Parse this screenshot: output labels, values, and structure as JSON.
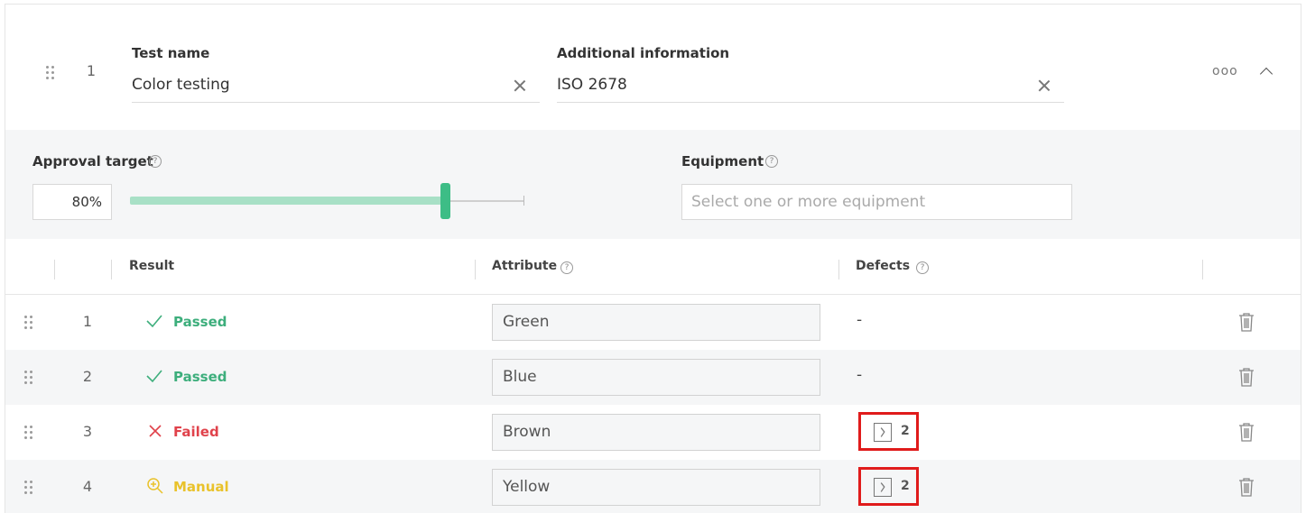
{
  "header": {
    "index": "1",
    "test_name_label": "Test name",
    "test_name_value": "Color testing",
    "additional_label": "Additional information",
    "additional_value": "ISO 2678",
    "more_icon": "ooo",
    "collapse_icon": "chevron-up-icon"
  },
  "settings": {
    "approval_label": "Approval target",
    "approval_value": "80%",
    "approval_level": 0.8,
    "equipment_label": "Equipment",
    "equipment_placeholder": "Select one or more equipment",
    "help_icon": "?"
  },
  "table": {
    "columns": [
      "Result",
      "Attribute",
      "Defects"
    ],
    "rows": [
      {
        "index": "1",
        "result": "Passed",
        "status": "passed",
        "attribute": "Green",
        "defects": "-"
      },
      {
        "index": "2",
        "result": "Passed",
        "status": "passed",
        "attribute": "Blue",
        "defects": "-"
      },
      {
        "index": "3",
        "result": "Failed",
        "status": "failed",
        "attribute": "Brown",
        "defects": "2"
      },
      {
        "index": "4",
        "result": "Manual",
        "status": "manual",
        "attribute": "Yellow",
        "defects": "2"
      }
    ]
  },
  "colors": {
    "passed": "#3dae7c",
    "failed": "#e0424b",
    "manual": "#e9c22b",
    "accent": "#3dbd86",
    "highlight": "#e01b1b"
  }
}
